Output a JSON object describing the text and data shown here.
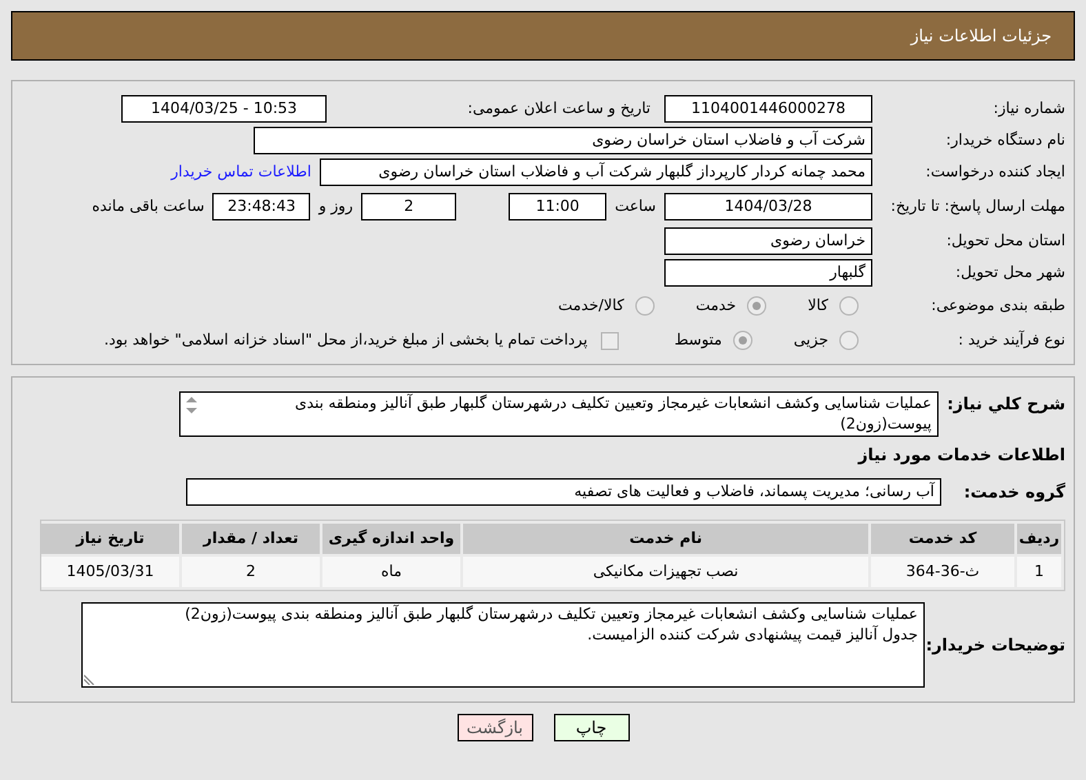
{
  "header": {
    "title": "جزئیات اطلاعات نیاز"
  },
  "need_number": {
    "label": "شماره نیاز:",
    "value": "1104001446000278"
  },
  "announce": {
    "label": "تاریخ و ساعت اعلان عمومی:",
    "value": "1404/03/25 - 10:53"
  },
  "buyer": {
    "label": "نام دستگاه خریدار:",
    "value": "شرکت آب و فاضلاب استان خراسان رضوی"
  },
  "creator": {
    "label": "ایجاد کننده درخواست:",
    "value": "محمد چمانه کردار کارپرداز گلبهار  شرکت آب و فاضلاب استان خراسان رضوی",
    "link": "اطلاعات تماس خریدار"
  },
  "deadline": {
    "label": "مهلت ارسال پاسخ: تا تاریخ:",
    "date": "1404/03/28",
    "time_label": "ساعت",
    "time": "11:00",
    "days": "2",
    "days_label": "روز و",
    "remaining": "23:48:43",
    "remaining_label": "ساعت باقی مانده"
  },
  "province": {
    "label": "استان محل تحویل:",
    "value": "خراسان رضوی"
  },
  "city": {
    "label": "شهر محل تحویل:",
    "value": "گلبهار"
  },
  "category": {
    "label": "طبقه بندی موضوعی:",
    "options": [
      {
        "label": "کالا",
        "selected": false
      },
      {
        "label": "خدمت",
        "selected": true
      },
      {
        "label": "کالا/خدمت",
        "selected": false
      }
    ]
  },
  "process": {
    "label": "نوع فرآیند خرید :",
    "options": [
      {
        "label": "جزیی",
        "selected": false
      },
      {
        "label": "متوسط",
        "selected": true
      }
    ],
    "payment": {
      "checked": false,
      "text": "پرداخت تمام یا بخشی از مبلغ خرید،از محل \"اسناد خزانه اسلامی\" خواهد بود."
    }
  },
  "description": {
    "label": "شرح کلي نياز:",
    "value": "عملیات شناسایی وکشف انشعابات غیرمجاز وتعیین تکلیف درشهرستان گلبهار طبق آنالیز ومنطقه بندی پیوست(زون2)"
  },
  "services_heading": "اطلاعات خدمات مورد نیاز",
  "service_group": {
    "label": "گروه خدمت:",
    "value": "آب رسانی؛ مدیریت پسماند، فاضلاب و فعالیت های تصفیه"
  },
  "table": {
    "columns": [
      "ردیف",
      "کد خدمت",
      "نام خدمت",
      "واحد اندازه گیری",
      "تعداد / مقدار",
      "تاریخ نیاز"
    ],
    "rows": [
      [
        "1",
        "ث-36-364",
        "نصب تجهیزات مکانیکی",
        "ماه",
        "2",
        "1405/03/31"
      ]
    ]
  },
  "buyer_notes": {
    "label": "توضیحات خریدار:",
    "lines": [
      "عملیات شناسایی وکشف انشعابات غیرمجاز وتعیین تکلیف درشهرستان گلبهار طبق آنالیز ومنطقه بندی پیوست(زون2)",
      "جدول آنالیز قیمت پیشنهادی شرکت کننده الزامیست."
    ]
  },
  "buttons": [
    {
      "label": "چاپ",
      "kind": "print"
    },
    {
      "label": "بازگشت",
      "kind": "back"
    }
  ]
}
